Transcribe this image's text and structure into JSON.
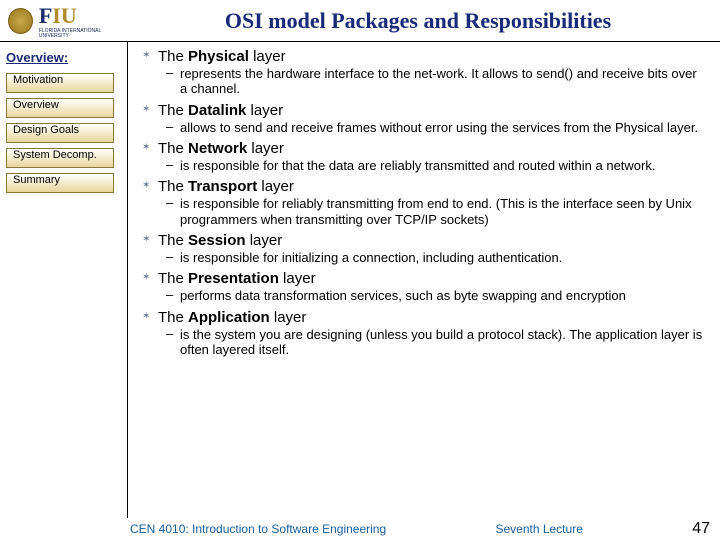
{
  "header": {
    "title": "OSI model Packages and Responsibilities",
    "logo_f": "F",
    "logo_iu": "IU",
    "logo_sub": "FLORIDA INTERNATIONAL UNIVERSITY"
  },
  "sidebar": {
    "title": "Overview:",
    "items": [
      {
        "label": "Motivation"
      },
      {
        "label": "Overview"
      },
      {
        "label": "Design Goals"
      },
      {
        "label": "System Decomp."
      },
      {
        "label": "Summary"
      }
    ]
  },
  "layers": [
    {
      "title_pre": "The ",
      "title_bold": "Physical ",
      "title_post": "layer",
      "desc": "represents the hardware interface to the net-work. It allows to send() and receive bits over a channel."
    },
    {
      "title_pre": "The ",
      "title_bold": "Datalink ",
      "title_post": "layer",
      "desc": "allows to send and receive frames without error using the services from the Physical layer."
    },
    {
      "title_pre": "The ",
      "title_bold": "Network ",
      "title_post": "layer",
      "desc": "is responsible for that the data are reliably transmitted and routed within a network."
    },
    {
      "title_pre": "The ",
      "title_bold": "Transport ",
      "title_post": "layer",
      "desc": "is responsible for reliably transmitting from end to end. (This is the interface seen by Unix programmers when transmitting over TCP/IP sockets)"
    },
    {
      "title_pre": "The ",
      "title_bold": "Session ",
      "title_post": "layer",
      "desc": "is responsible for initializing a connection, including authentication."
    },
    {
      "title_pre": "The ",
      "title_bold": "Presentation ",
      "title_post": "layer",
      "desc": "performs data transformation services, such as byte swapping and encryption"
    },
    {
      "title_pre": "The ",
      "title_bold": "Application ",
      "title_post": "layer",
      "desc": "is the system you are designing (unless you build a protocol stack). The application layer is often layered itself."
    }
  ],
  "footer": {
    "left": "CEN 4010: Introduction to Software Engineering",
    "center": "Seventh Lecture",
    "right": "47"
  }
}
